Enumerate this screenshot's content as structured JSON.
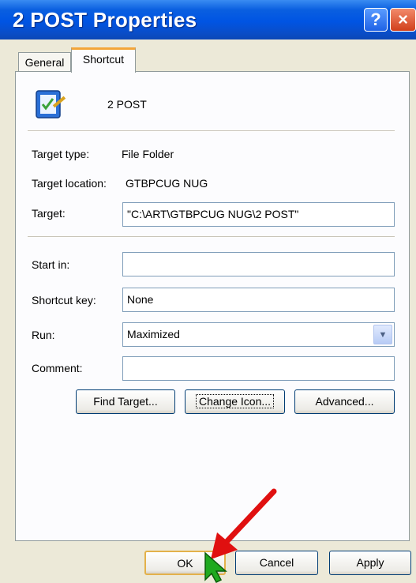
{
  "window": {
    "title": "2 POST Properties"
  },
  "tabs": [
    {
      "label": "General"
    },
    {
      "label": "Shortcut"
    }
  ],
  "shortcut": {
    "name": "2 POST",
    "target_type_label": "Target type:",
    "target_type_value": "File Folder",
    "target_location_label": "Target location:",
    "target_location_value": "GTBPCUG NUG",
    "target_label": "Target:",
    "target_value": "\"C:\\ART\\GTBPCUG NUG\\2 POST\"",
    "start_in_label": "Start in:",
    "start_in_value": "",
    "shortcut_key_label": "Shortcut key:",
    "shortcut_key_value": "None",
    "run_label": "Run:",
    "run_value": "Maximized",
    "comment_label": "Comment:",
    "comment_value": "",
    "find_target": "Find Target...",
    "change_icon": "Change Icon...",
    "advanced": "Advanced..."
  },
  "footer": {
    "ok": "OK",
    "cancel": "Cancel",
    "apply": "Apply"
  },
  "colors": {
    "titlebar": "#0054e3",
    "dialog_bg": "#ece9d8",
    "tab_accent": "#f3a53a",
    "annotation_arrow": "#e01010",
    "cursor": "#1fa91f"
  },
  "icons": {
    "help": "?",
    "close": "×",
    "combo": "▼"
  }
}
